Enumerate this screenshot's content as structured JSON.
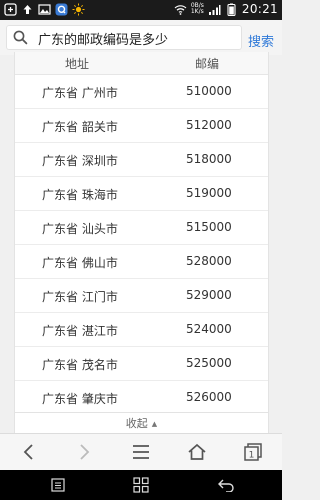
{
  "status_bar": {
    "time": "20:21",
    "net_speed_up": "0B/s",
    "net_speed_down": "1K/s"
  },
  "search": {
    "query": "广东的邮政编码是多少",
    "button_label": "搜索"
  },
  "table": {
    "columns": [
      "地址",
      "邮编"
    ],
    "rows": [
      {
        "city": "广东省 广州市",
        "code": "510000"
      },
      {
        "city": "广东省 韶关市",
        "code": "512000"
      },
      {
        "city": "广东省 深圳市",
        "code": "518000"
      },
      {
        "city": "广东省 珠海市",
        "code": "519000"
      },
      {
        "city": "广东省 汕头市",
        "code": "515000"
      },
      {
        "city": "广东省 佛山市",
        "code": "528000"
      },
      {
        "city": "广东省 江门市",
        "code": "529000"
      },
      {
        "city": "广东省 湛江市",
        "code": "524000"
      },
      {
        "city": "广东省 茂名市",
        "code": "525000"
      },
      {
        "city": "广东省 肇庆市",
        "code": "526000"
      }
    ],
    "collapse_label": "收起"
  },
  "browser_toolbar": {
    "tab_count": "1"
  },
  "icons": {
    "search": "search-icon",
    "back": "back-arrow-icon",
    "forward": "forward-arrow-icon",
    "menu": "menu-icon",
    "home": "home-icon",
    "tabs": "tabs-icon"
  },
  "colors": {
    "accent": "#2f79d8"
  }
}
